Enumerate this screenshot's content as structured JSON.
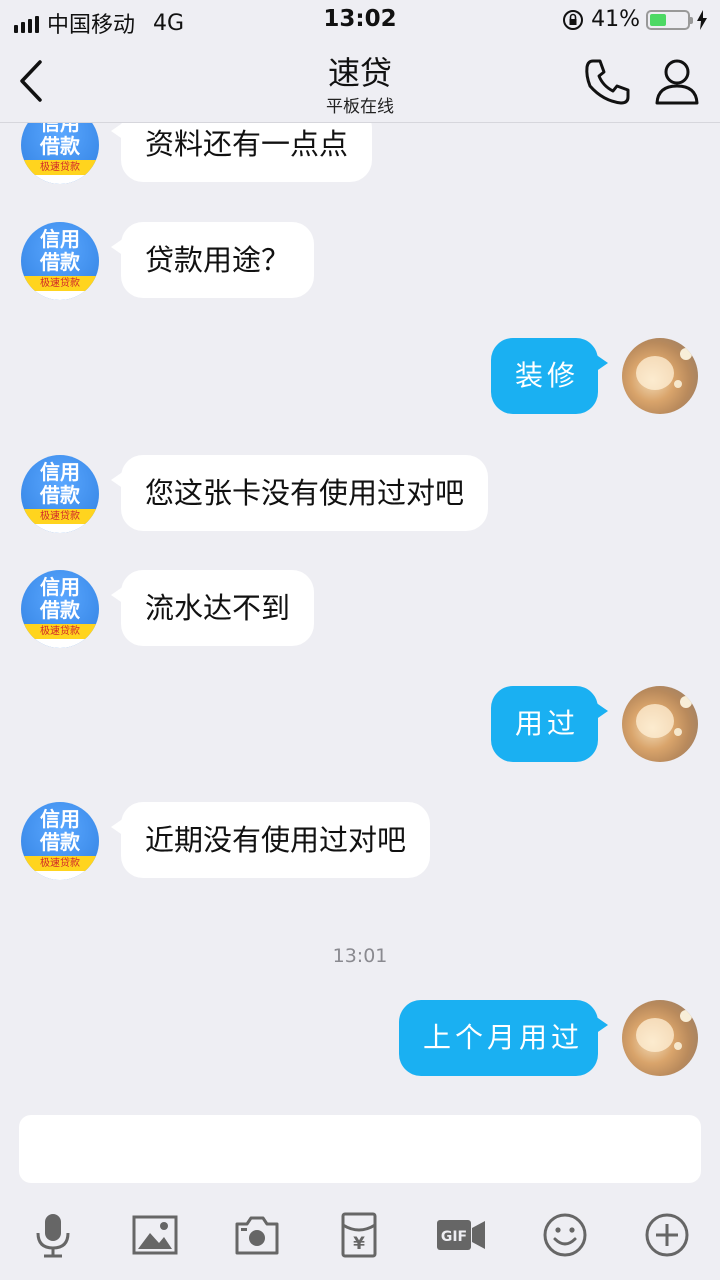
{
  "status_bar": {
    "carrier": "中国移动",
    "network": "4G",
    "time": "13:02",
    "battery_percent": "41%",
    "battery_level": 0.41
  },
  "nav": {
    "title": "速贷",
    "subtitle": "平板在线"
  },
  "bot_avatar": {
    "line1": "信用",
    "line2": "借款",
    "tag": "极速贷款"
  },
  "messages": [
    {
      "from": "them",
      "text": "资料还有一点点"
    },
    {
      "from": "them",
      "text": "贷款用途？"
    },
    {
      "from": "me",
      "text": "装修"
    },
    {
      "from": "them",
      "text": "您这张卡没有使用过对吧"
    },
    {
      "from": "them",
      "text": "流水达不到"
    },
    {
      "from": "me",
      "text": "用过"
    },
    {
      "from": "them",
      "text": "近期没有使用过对吧"
    },
    {
      "from": "me",
      "text": "上个月用过"
    }
  ],
  "timestamp": "13:01",
  "input": {
    "value": "",
    "placeholder": ""
  },
  "toolbar_icons": [
    "microphone-icon",
    "image-icon",
    "camera-icon",
    "red-packet-icon",
    "gif-icon",
    "emoji-icon",
    "plus-icon"
  ],
  "colors": {
    "background": "#eeeef3",
    "outgoing_bubble": "#1ab0f2",
    "incoming_bubble": "#ffffff",
    "bot_avatar": "#3a8ff0"
  }
}
